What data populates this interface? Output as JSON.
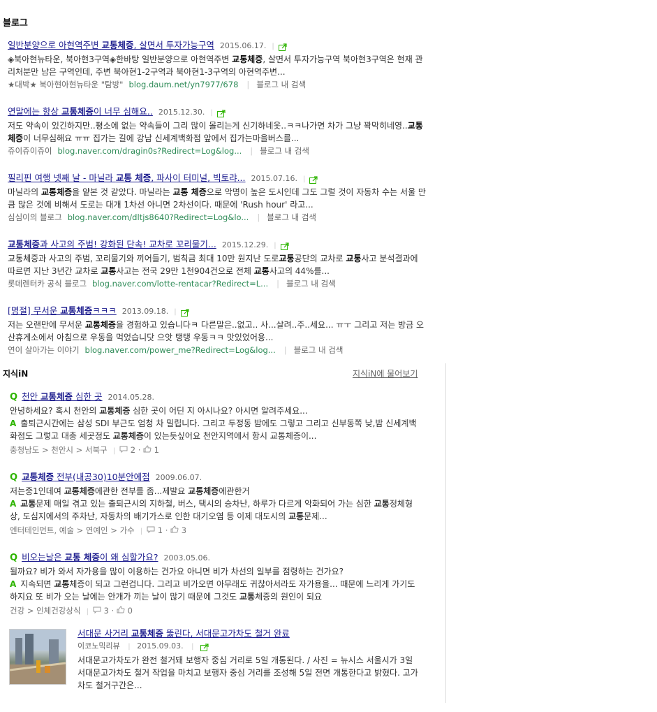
{
  "blog_section": {
    "title": "블로그",
    "items": [
      {
        "title_parts": [
          "일반분양으로 아현역주변 ",
          "교통체증",
          ", 살면서 투자가능구역"
        ],
        "date": "2015.06.17.",
        "desc_parts": [
          "◈북아현뉴타운, 북아현3구역◈한바탕 일반분양으로 아현역주변 ",
          "교통체증",
          ", 살면서 투자가능구역 북아현3구역은 현재 관리처분만 남은 구역인데, 주변 북아현1-2구역과 북아현1-3구역의 아현역주변..."
        ],
        "source": "★대박★ 북아현아현뉴타운 \"탐방\"",
        "url": "blog.daum.net/yn7977/678",
        "in_blog": "블로그 내 검색"
      },
      {
        "title_parts": [
          "연말에는 항상 ",
          "교통체증",
          "이 너무 심해요.."
        ],
        "date": "2015.12.30.",
        "desc_parts": [
          "저도 약속이 있긴하지만..평소에 없는 약속들이 그리 많이 몰리는게 신기하네옷..ㅋㅋ나가면 차가 그냥 꽉막히네영..",
          "교통체증",
          "이 너무심해요 ㅠㅠ 집가는 길에 강남 신세계백화점 앞에서 집가는마을버스를..."
        ],
        "source": "쥬이쥬이쥬이",
        "url": "blog.naver.com/dragin0s?Redirect=Log&log...",
        "in_blog": "블로그 내 검색"
      },
      {
        "title_parts": [
          "필리핀 여행 넷째 날 - 마닐라 ",
          "교통 체증",
          ", 파사이 터미널, 빅토랴..."
        ],
        "date": "2015.07.16.",
        "desc_parts": [
          "마닐라의 ",
          "교통체증",
          "을 얕본 것 같았다. 마닐라는 ",
          "교통 체증",
          "으로 악명이 높은 도시인데 그도 그럴 것이 자동차 수는 서울 만큼 많은 것에 비해서 도로는 대개 1차선 아니면 2차선이다. 때문에 'Rush hour' 라고..."
        ],
        "source": "심심이의 블로그",
        "url": "blog.naver.com/dltjs8640?Redirect=Log&lo...",
        "in_blog": "블로그 내 검색"
      },
      {
        "title_parts": [
          "",
          "교통체증",
          "과 사고의 주범! 강화된 단속! 교차로 꼬리물기..."
        ],
        "date": "2015.12.29.",
        "desc_parts": [
          "교통체증과 사고의 주범, 꼬리물기와 끼어들기, 범칙금 최대 10만 원지난 도로",
          "교통",
          "공단의 교차로 ",
          "교통",
          "사고 분석결과에 따르면 지난 3년간 교차로 ",
          "교통",
          "사고는 전국 29만 1천904건으로 전체 ",
          "교통",
          "사고의 44%를..."
        ],
        "source": "롯데렌터카 공식 블로그",
        "url": "blog.naver.com/lotte-rentacar?Redirect=L...",
        "in_blog": "블로그 내 검색"
      },
      {
        "title_parts": [
          "[명절] 무서운 ",
          "교통체증",
          "ㅋㅋㅋ"
        ],
        "date": "2013.09.18.",
        "desc_parts": [
          "저는 오랜만에 무서운 ",
          "교통체증",
          "을 경험하고 있습니다ㅋ 다른말은..없고.. 사...살려..주..세요... ㅠㅜ 그리고 저는 방금 오산휴게소에서 아침으로 우동을 먹었습니닷 으앗 탱탱 우동ㅋㅋ 맛있었어용..."
        ],
        "source": "연이 살아가는 이야기",
        "url": "blog.naver.com/power_me?Redirect=Log&log...",
        "in_blog": "블로그 내 검색"
      }
    ]
  },
  "kin_section": {
    "title": "지식iN",
    "ask_link": "지식iN에 물어보기",
    "q_mark": "Q",
    "a_mark": "A",
    "items": [
      {
        "title_parts": [
          "천안 ",
          "교통체증",
          " 심한 곳"
        ],
        "date": "2014.05.28.",
        "question_parts": [
          "안녕하세요? 혹시 천안의 ",
          "교통체증",
          " 심한 곳이 어딘 지 아시나요? 아시면 알려주세요..."
        ],
        "answer_parts": [
          "출퇴근시간에는 삼성 SDI 부근도 엄청 차 밀립니다. 그리고 두정동 밤에도 그렇고 그리고 신부동쪽 낮,밤 신세계백화점도 그렇고 대충 세곳정도 ",
          "교통체증",
          "이 있는듯싶어요 천안지역에서 항시 교통체증이..."
        ],
        "category": "충청남도 > 천안시 > 서북구",
        "answers": "2",
        "likes": "1"
      },
      {
        "title_parts": [
          "",
          "교통체증",
          " 전부(내공30)10분안에점"
        ],
        "date": "2009.06.07.",
        "question_parts": [
          "저는중1인데여 ",
          "교통체증",
          "에관한 전부를 좀...제발요 ",
          "교통체증",
          "에관한거"
        ],
        "answer_parts": [
          "",
          "교통",
          "문제 매일 겪고 있는 출퇴근시의 지하철, 버스, 택시의 승차난, 하루가 다르게 악화되어 가는 심한 ",
          "교통",
          "정체형상, 도심지에서의 주차난, 자동차의 배기가스로 인한 대기오염 등 이제 대도시의 ",
          "교통",
          "문제..."
        ],
        "category": "엔터테인먼트, 예술 > 연예인 > 가수",
        "answers": "1",
        "likes": "3"
      },
      {
        "title_parts": [
          "비오는날은 ",
          "교통 체증",
          "이 왜 심할가요?"
        ],
        "date": "2003.05.06.",
        "question_parts": [
          "될까요? 비가 와서 자가용을 많이 이용하는 건가요 아니면 비가 차선의 일부를 점령하는 건가요?"
        ],
        "answer_parts": [
          "지속되면 ",
          "교통",
          "체증이 되고 그런겁니다. 그리고 비가오면 아무래도 귀찮아서라도 자가용을... 때문에 느리게 가기도 하지요 또 비가 오는 날에는 안개가 끼는 날이 많기 때문에 그것도 ",
          "교통",
          "체증의 원인이 되요"
        ],
        "category": "건강 > 인체건강상식",
        "answers": "3",
        "likes": "0"
      }
    ]
  },
  "news": {
    "title_parts": [
      "서대문 사거리 ",
      "교통체증",
      " 뚫린다, 서대문고가차도 철거 완료"
    ],
    "source": "이코노믹리뷰",
    "date": "2015.09.03.",
    "desc": "서대문고가차도가 완전 철거돼 보행자 중심 거리로 5일 개통된다. / 사진 = 뉴시스 서울시가 3일 서대문고가차도 철거 작업을 마치고 보행자 중심 거리를 조성해 5일 전면 개통한다고 밝혔다. 고가차도 철거구간은..."
  },
  "icons": {
    "share": "share-icon",
    "comment": "comment-icon",
    "like": "like-icon"
  },
  "colors": {
    "link": "#1c1c8e",
    "url": "#2e8b57",
    "kin_green": "#2db400"
  }
}
